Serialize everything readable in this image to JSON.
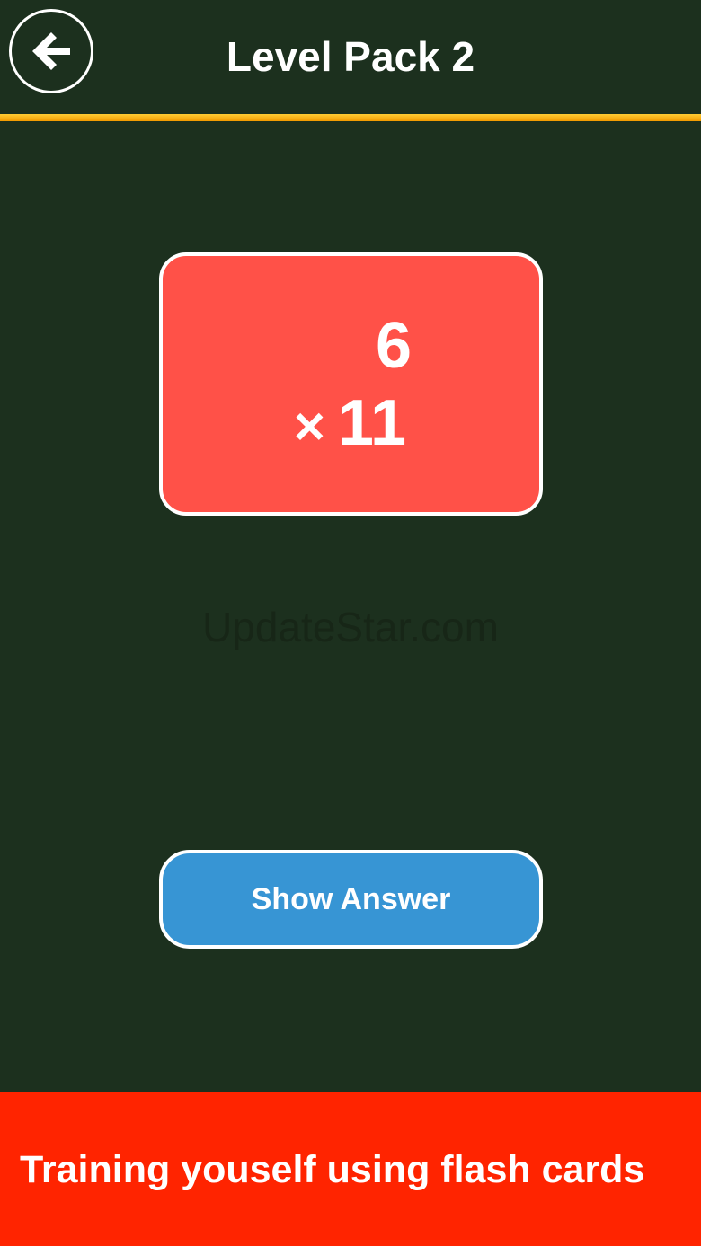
{
  "header": {
    "title": "Level Pack 2",
    "back_icon": "arrow-left-icon"
  },
  "card": {
    "top_number": "6",
    "operator": "×",
    "bottom_number": "11",
    "color": "#ff5148"
  },
  "watermark": "UpdateStar.com",
  "actions": {
    "show_answer_label": "Show Answer",
    "color": "#3795d4"
  },
  "banner": {
    "text": "Training youself using flash cards",
    "color": "#ff2400"
  },
  "colors": {
    "background": "#1c301e",
    "accent_stripe": "#ffcc33"
  }
}
